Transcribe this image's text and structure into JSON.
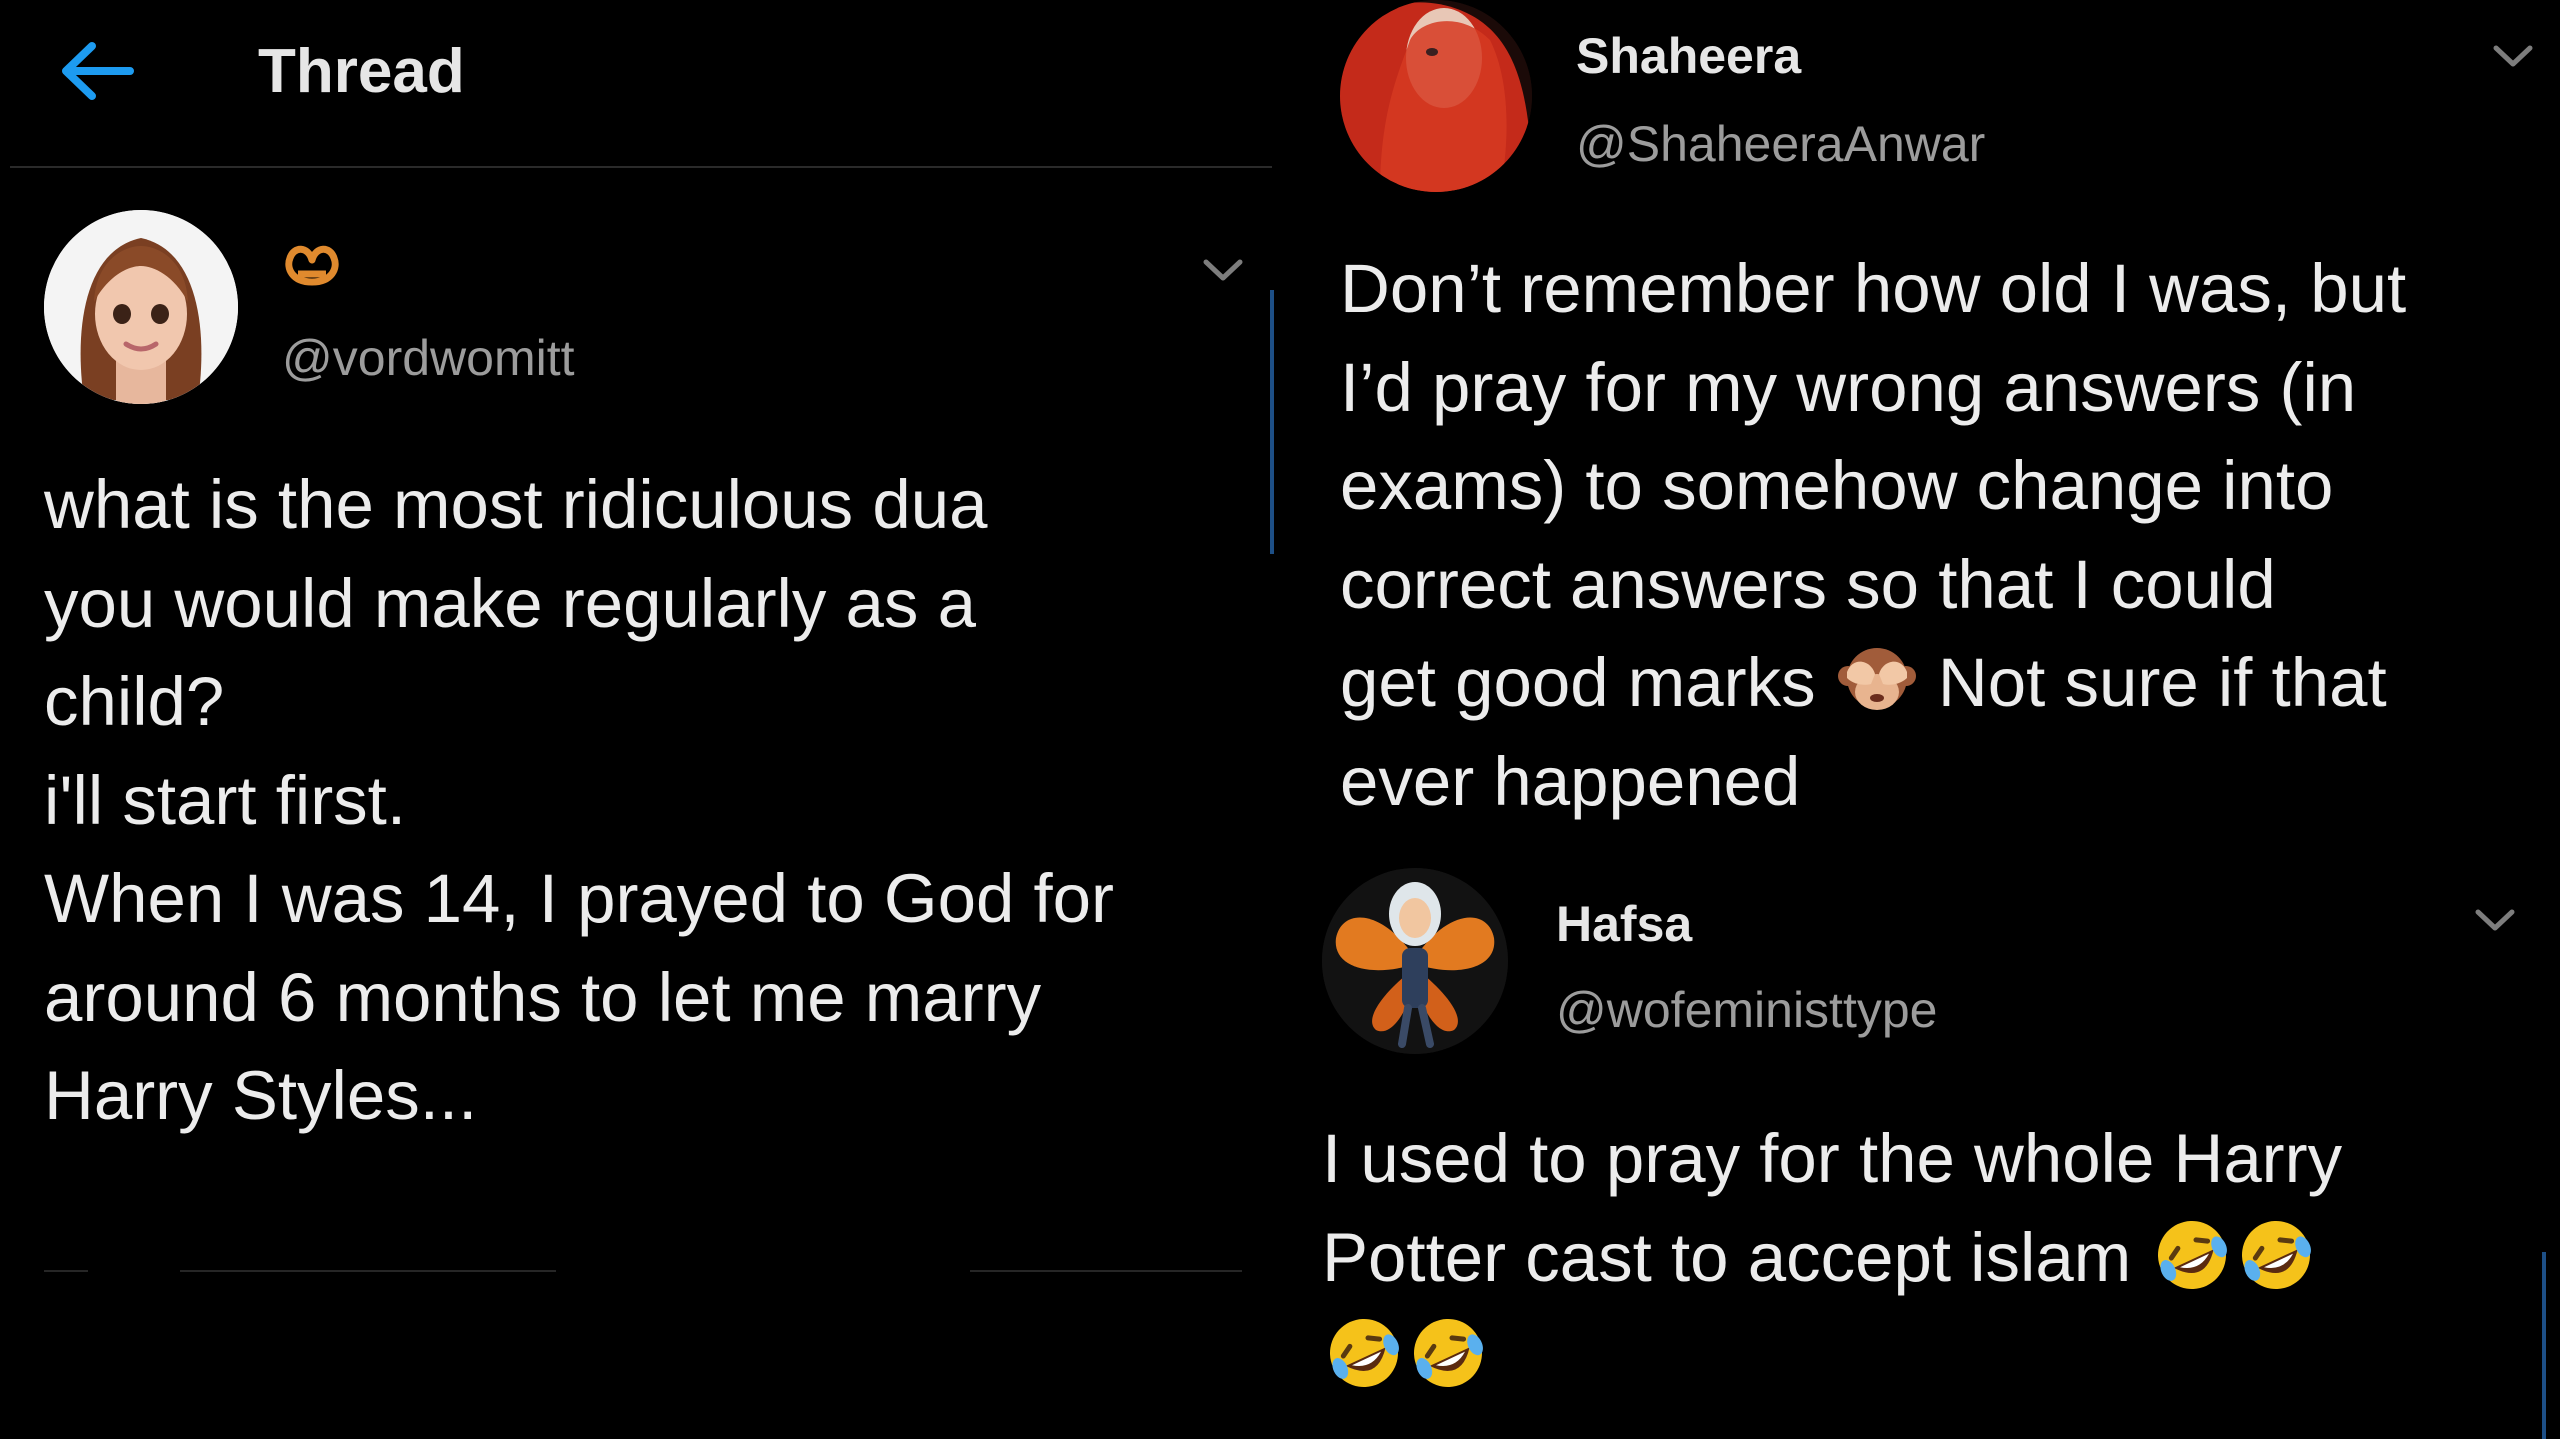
{
  "header": {
    "title": "Thread",
    "back_icon": "arrow-left-icon",
    "accent": "#1d9bf0"
  },
  "tweets": [
    {
      "name_icon": "pretzel-icon",
      "handle": "@vordwomitt",
      "text": "what is the most ridiculous dua\nyou would make regularly as a\nchild?\ni'll start first.\nWhen I was 14, I prayed to God for\naround 6 months to let me marry\nHarry Styles..."
    },
    {
      "name": "Shaheera",
      "handle": "@ShaheeraAnwar",
      "text_before_emoji": "Don’t remember how old I was, but\nI’d pray for my wrong answers (in\nexams) to somehow change into\ncorrect answers so that I could\nget good marks ",
      "emoji": "see-no-evil-monkey-icon",
      "text_after_emoji": " Not sure if that\never happened"
    },
    {
      "name": "Hafsa",
      "handle": "@wofeministtype",
      "text_before_emoji": "I used to pray for the whole Harry\nPotter cast to accept islam ",
      "emoji": "rolling-on-floor-laughing-icon"
    }
  ],
  "colors": {
    "background": "#000000",
    "text": "#ececec",
    "handle": "#9c9c9c",
    "thread_line": "#1d4f86"
  }
}
